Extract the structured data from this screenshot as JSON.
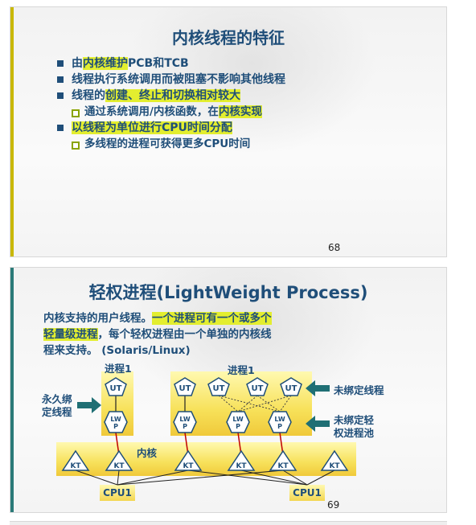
{
  "slide1": {
    "title": "内核线程的特征",
    "bullets": [
      {
        "pre": "由",
        "hl": "内核维护",
        "post": "PCB和TCB"
      },
      {
        "pre": "线程执行系统调用而被阻塞不影响其他线程",
        "hl": "",
        "post": ""
      },
      {
        "pre": "线程的",
        "hl": "创建、终止和切换相对较大",
        "post": ""
      }
    ],
    "sub1": {
      "pre": "通过系统调用/内核函数，在",
      "hl": "内核实现",
      "post": ""
    },
    "bullet4": {
      "pre": "",
      "hl": "以线程为单位进行CPU时间分配",
      "post": ""
    },
    "sub2": "多线程的进程可获得更多CPU时间",
    "page": "68"
  },
  "slide2": {
    "title": "轻权进程(LightWeight Process)",
    "para_line1_pre": "内核支持的用户线程。",
    "para_line1_hl": "一个进程可有一个或多个",
    "para_line2_hl": "轻量级进程",
    "para_line2_post": "，每个轻权进程由一个单独的内核线",
    "para_line3": "程来支持。 (Solaris/Linux)",
    "process1_left": "进程1",
    "process1_right": "进程1",
    "bound_label_1": "永久绑",
    "bound_label_2": "定线程",
    "unbound_thread": "未绑定线程",
    "unbound_pool_1": "未绑定轻",
    "unbound_pool_2": "权进程池",
    "kernel": "内核",
    "ut": "UT",
    "lwp": "LW\nP",
    "kt": "KT",
    "cpu_left": "CPU1",
    "cpu_right": "CPU1",
    "page": "69"
  },
  "colors": {
    "title_blue": "#1f4e79",
    "accent_teal": "#1f6f74",
    "highlight_yellow": "#e3ee2f",
    "box_yellow": "#f7e15a",
    "link_red": "#c00000"
  }
}
